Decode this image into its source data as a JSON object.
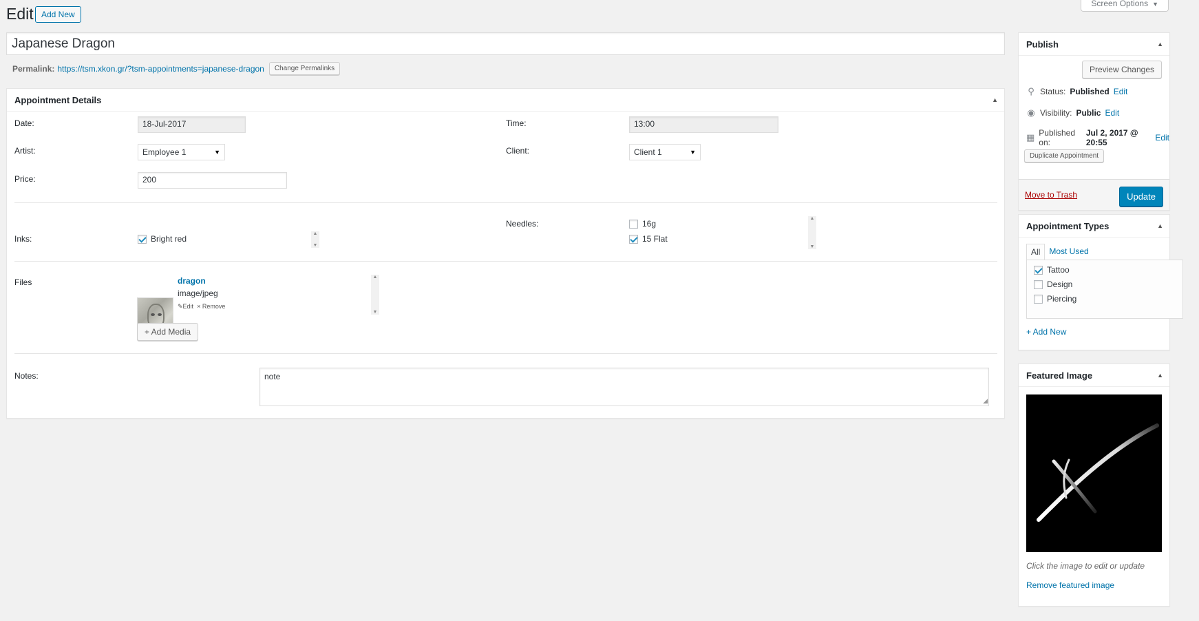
{
  "header": {
    "title": "Edit",
    "add_new": "Add New",
    "screen_options": "Screen Options"
  },
  "post": {
    "title": "Japanese Dragon",
    "permalink_label": "Permalink:",
    "permalink_url": "https://tsm.xkon.gr/?tsm-appointments=japanese-dragon",
    "change_permalinks": "Change Permalinks"
  },
  "details": {
    "heading": "Appointment Details",
    "date_label": "Date:",
    "date_value": "18-Jul-2017",
    "time_label": "Time:",
    "time_value": "13:00",
    "artist_label": "Artist:",
    "artist_value": "Employee 1",
    "client_label": "Client:",
    "client_value": "Client 1",
    "price_label": "Price:",
    "price_value": "200",
    "inks_label": "Inks:",
    "inks": [
      {
        "label": "Bright red",
        "checked": true
      }
    ],
    "needles_label": "Needles:",
    "needles": [
      {
        "label": "16g",
        "checked": false
      },
      {
        "label": "15 Flat",
        "checked": true
      }
    ],
    "files_label": "Files",
    "file": {
      "name": "dragon",
      "type": "image/jpeg",
      "edit": "Edit",
      "remove": "Remove"
    },
    "add_media": "+ Add Media",
    "notes_label": "Notes:",
    "notes_value": "note"
  },
  "publish": {
    "heading": "Publish",
    "preview": "Preview Changes",
    "status_label": "Status:",
    "status_value": "Published",
    "visibility_label": "Visibility:",
    "visibility_value": "Public",
    "published_label": "Published on:",
    "published_value": "Jul 2, 2017 @ 20:55",
    "edit_link": "Edit",
    "duplicate": "Duplicate Appointment",
    "trash": "Move to Trash",
    "update": "Update"
  },
  "types": {
    "heading": "Appointment Types",
    "tab_all": "All",
    "tab_most_used": "Most Used",
    "items": [
      {
        "label": "Tattoo",
        "checked": true
      },
      {
        "label": "Design",
        "checked": false
      },
      {
        "label": "Piercing",
        "checked": false
      }
    ],
    "add_new": "+ Add New"
  },
  "featured": {
    "heading": "Featured Image",
    "caption": "Click the image to edit or update",
    "remove": "Remove featured image"
  },
  "icons": {
    "toggle": "triangle-up-icon",
    "status": "pin-icon",
    "visibility": "eye-icon",
    "calendar": "calendar-icon",
    "select": "caret-down-icon"
  },
  "colors": {
    "accent": "#0073aa",
    "primary_button": "#0085ba",
    "trash": "#a00000",
    "background": "#f1f1f1"
  }
}
